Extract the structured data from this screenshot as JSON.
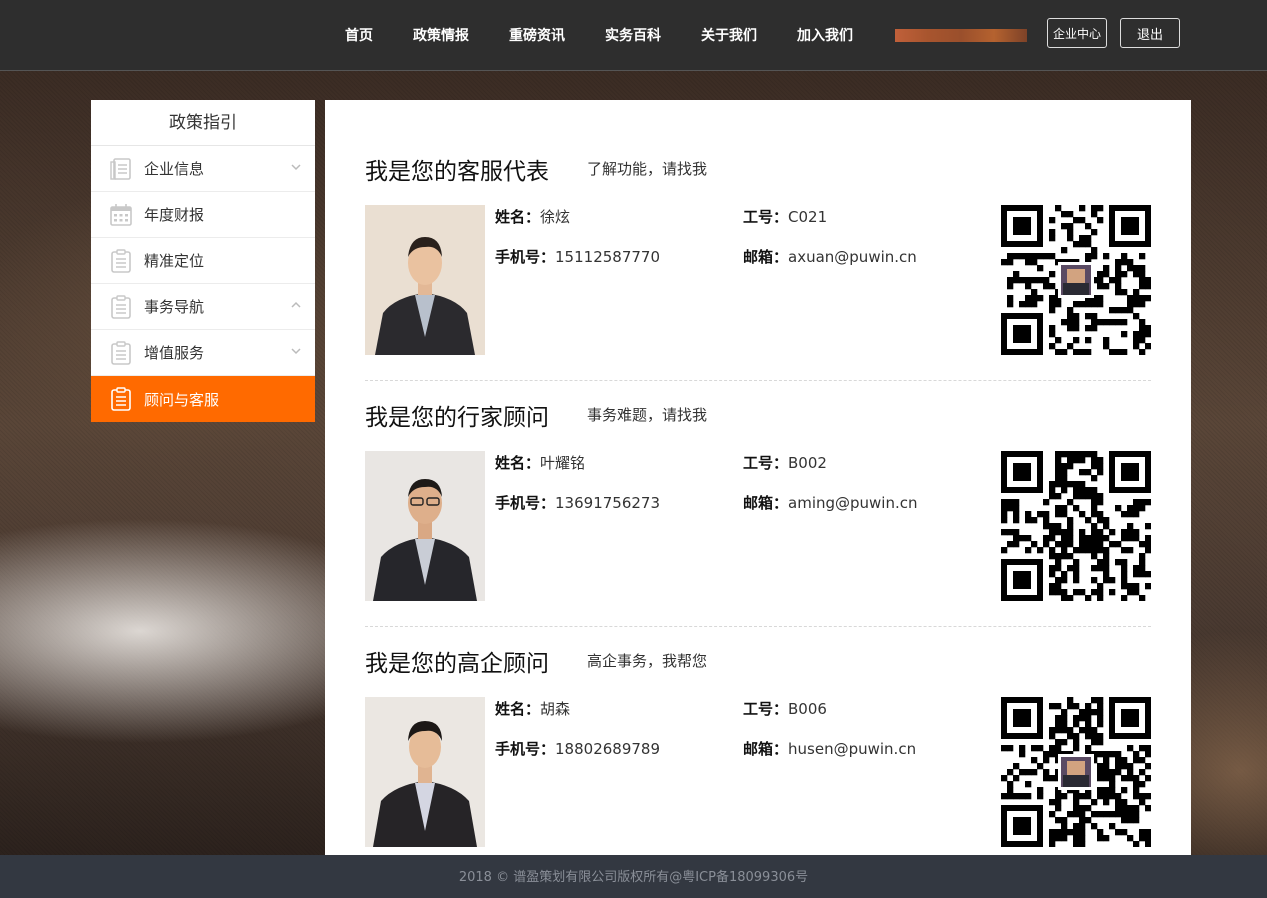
{
  "header": {
    "nav": [
      "首页",
      "政策情报",
      "重磅资讯",
      "实务百科",
      "关于我们",
      "加入我们"
    ],
    "enterprise_center": "企业中心",
    "logout": "退出"
  },
  "sidebar": {
    "title": "政策指引",
    "items": [
      {
        "label": "企业信息",
        "icon": "document-list-icon",
        "chevron": "chevron-down"
      },
      {
        "label": "年度财报",
        "icon": "calendar-icon",
        "chevron": ""
      },
      {
        "label": "精准定位",
        "icon": "clipboard-icon",
        "chevron": ""
      },
      {
        "label": "事务导航",
        "icon": "clipboard-icon",
        "chevron": "chevron-up"
      },
      {
        "label": "增值服务",
        "icon": "clipboard-icon",
        "chevron": "chevron-down"
      },
      {
        "label": "顾问与客服",
        "icon": "clipboard-icon",
        "chevron": "",
        "active": true
      }
    ]
  },
  "contacts": [
    {
      "title": "我是您的客服代表",
      "subtitle": "了解功能，请找我",
      "name_label": "姓名：",
      "name": "徐炫",
      "id_label": "工号：",
      "id": "C021",
      "phone_label": "手机号：",
      "phone": "15112587770",
      "email_label": "邮箱：",
      "email": "axuan@puwin.cn"
    },
    {
      "title": "我是您的行家顾问",
      "subtitle": "事务难题，请找我",
      "name_label": "姓名：",
      "name": "叶耀铭",
      "id_label": "工号：",
      "id": "B002",
      "phone_label": "手机号：",
      "phone": "13691756273",
      "email_label": "邮箱：",
      "email": "aming@puwin.cn"
    },
    {
      "title": "我是您的高企顾问",
      "subtitle": "高企事务，我帮您",
      "name_label": "姓名：",
      "name": "胡森",
      "id_label": "工号：",
      "id": "B006",
      "phone_label": "手机号：",
      "phone": "18802689789",
      "email_label": "邮箱：",
      "email": "husen@puwin.cn"
    }
  ],
  "footer": {
    "text": "2018 © 谱盈策划有限公司版权所有@粤ICP备18099306号"
  },
  "colors": {
    "accent": "#ff6a00",
    "header_bg": "#2e2e2e",
    "footer_bg": "#333841"
  }
}
